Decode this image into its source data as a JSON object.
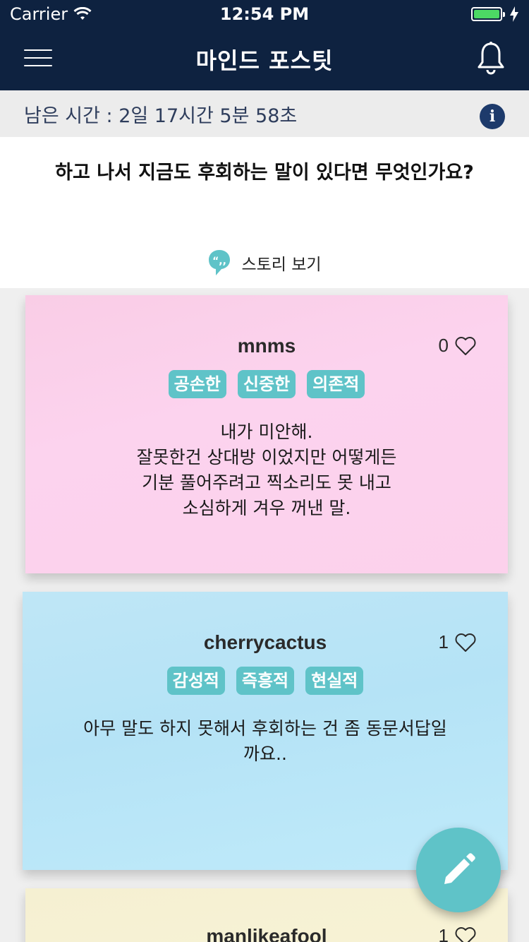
{
  "status_bar": {
    "carrier": "Carrier",
    "time": "12:54 PM"
  },
  "nav": {
    "title": "마인드 포스팃"
  },
  "timer": {
    "text": "남은 시간 : 2일 17시간 5분 58초",
    "info_label": "i"
  },
  "question": {
    "text": "하고 나서 지금도 후회하는 말이 있다면 무엇인가요?",
    "story_link": "스토리 보기"
  },
  "notes": [
    {
      "username": "mnms",
      "likes": "0",
      "tags": [
        "공손한",
        "신중한",
        "의존적"
      ],
      "body": "내가 미안해.\n잘못한건 상대방 이었지만 어떻게든\n기분 풀어주려고 찍소리도 못 내고\n소심하게 겨우 꺼낸 말.",
      "color": "#fcd1ec"
    },
    {
      "username": "cherrycactus",
      "likes": "1",
      "tags": [
        "감성적",
        "즉흥적",
        "현실적"
      ],
      "body": "아무 말도 하지 못해서 후회하는 건 좀 동문서답일\n까요..",
      "color": "#b8e4f7"
    },
    {
      "username": "manlikeafool",
      "likes": "1",
      "color": "#f7f2d5"
    }
  ],
  "colors": {
    "navy": "#0e2240",
    "accent": "#5fc3c8",
    "pink_note": "#fcd1ec",
    "blue_note": "#b8e4f7",
    "yellow_note": "#f7f2d5"
  },
  "icons": {
    "menu": "hamburger-menu-icon",
    "bell": "bell-icon",
    "info": "info-icon",
    "bubble": "speech-bubble-icon",
    "heart": "heart-outline-icon",
    "fab": "pencil-icon"
  }
}
